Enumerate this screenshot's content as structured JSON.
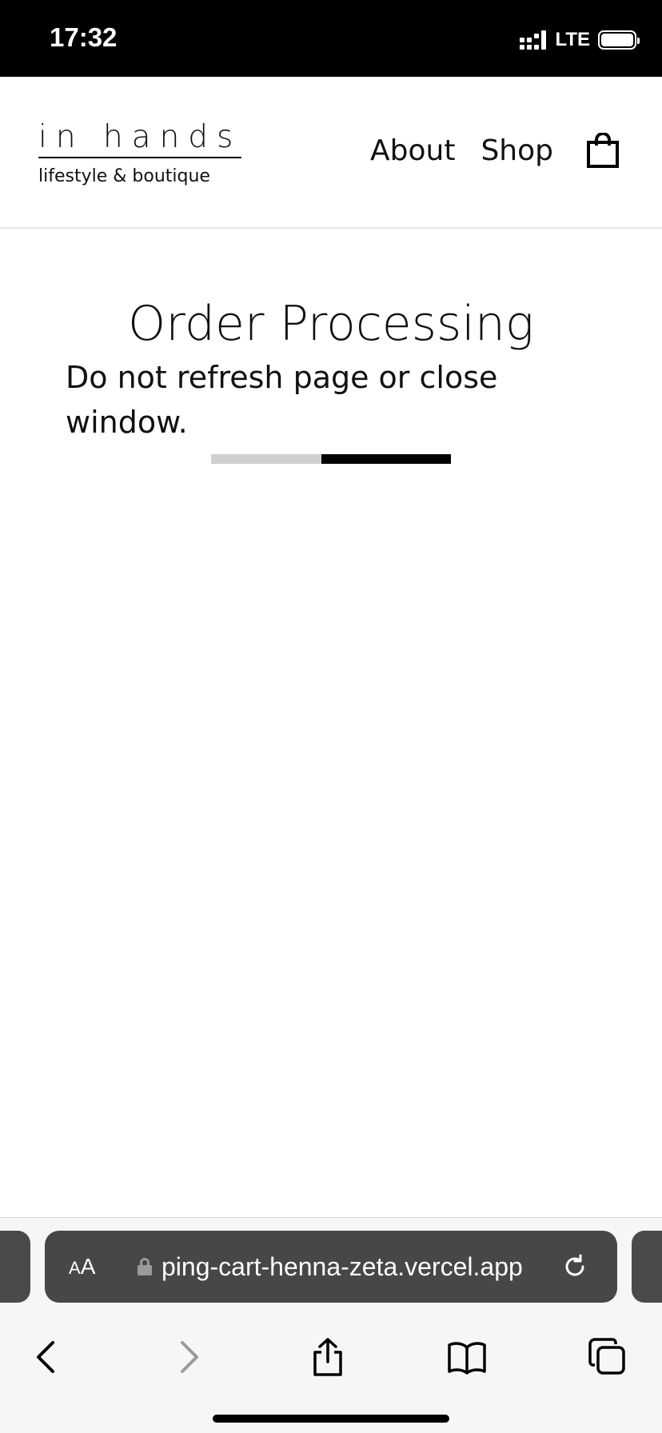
{
  "status_bar": {
    "time": "17:32",
    "network": "LTE",
    "icons": [
      "signal-icon",
      "battery-icon"
    ]
  },
  "header": {
    "logo_title": "in hands",
    "logo_subtitle": "lifestyle & boutique",
    "nav": [
      {
        "label": "About"
      },
      {
        "label": "Shop"
      }
    ],
    "cart_icon": "shopping-bag-icon"
  },
  "main": {
    "title": "Order Processing",
    "message": "Do not refresh page or close window.",
    "progress": {
      "track_color": "#cfcfcf",
      "bar_color": "#000000"
    }
  },
  "browser": {
    "text_size_label_small": "A",
    "text_size_label_large": "A",
    "url": "ping-cart-henna-zeta.vercel.app",
    "icons": [
      "lock-icon",
      "reload-icon",
      "back-icon",
      "forward-icon",
      "share-icon",
      "bookmarks-icon",
      "tabs-icon"
    ]
  }
}
